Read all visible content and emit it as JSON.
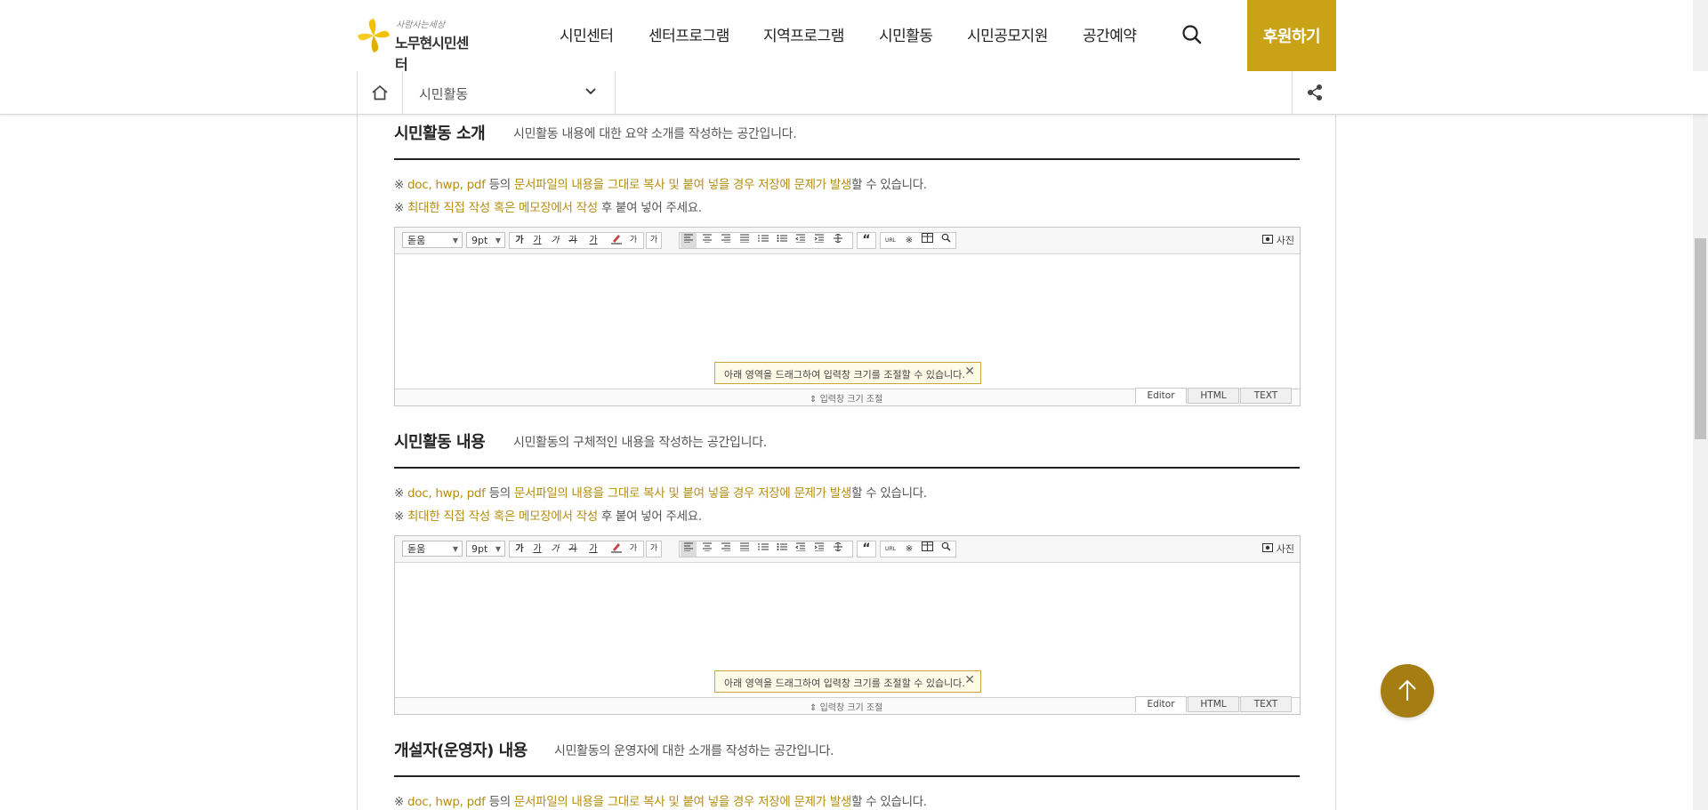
{
  "header": {
    "logo": {
      "tagline": "사람사는세상",
      "name": "노무현시민센터"
    },
    "nav": [
      "시민센터",
      "센터프로그램",
      "지역프로그램",
      "시민활동",
      "시민공모지원",
      "공간예약"
    ],
    "donate_label": "후원하기",
    "accent": "#c9a216"
  },
  "subbar": {
    "breadcrumb": "시민활동"
  },
  "sections": [
    {
      "title": "시민활동 소개",
      "desc": "시민활동 내용에 대한 요약 소개를 작성하는 공간입니다."
    },
    {
      "title": "시민활동 내용",
      "desc": "시민활동의 구체적인 내용을 작성하는 공간입니다."
    },
    {
      "title": "개설자(운영자) 내용",
      "desc": "시민활동의 운영자에 대한 소개를 작성하는 공간입니다."
    }
  ],
  "notices": {
    "line1": {
      "p1": "※ ",
      "h1": "doc, hwp, pdf",
      "p2": " 등의 ",
      "h2": "문서파일의 내용을 그대로 복사 및 붙여 넣을 경우 저장에 문제가 발생",
      "p3": "할 수 있습니다."
    },
    "line2": {
      "p1": "※ ",
      "h1": "최대한 직접 작성 혹은 메모장에서 작성",
      "p2": " 후 붙여 넣어 주세요."
    }
  },
  "editor": {
    "font": "돋움",
    "size": "9pt",
    "format_buttons": [
      "가",
      "가",
      "가",
      "가",
      "가",
      "가",
      "가",
      "가"
    ],
    "photo_label": "사진",
    "tip": "아래 영역을 드래그하여 입력창 크기를 조절할 수 있습니다.",
    "tip_close": "✕",
    "resize_label": "입력창 크기 조절",
    "modes": [
      "Editor",
      "HTML",
      "TEXT"
    ]
  },
  "icons": [
    "home-icon",
    "chevron-down-icon",
    "share-icon",
    "search-icon",
    "arrow-up-icon",
    "photo-icon"
  ],
  "colors": {
    "highlight": "#b58d12",
    "top_button": "#a57d12"
  }
}
